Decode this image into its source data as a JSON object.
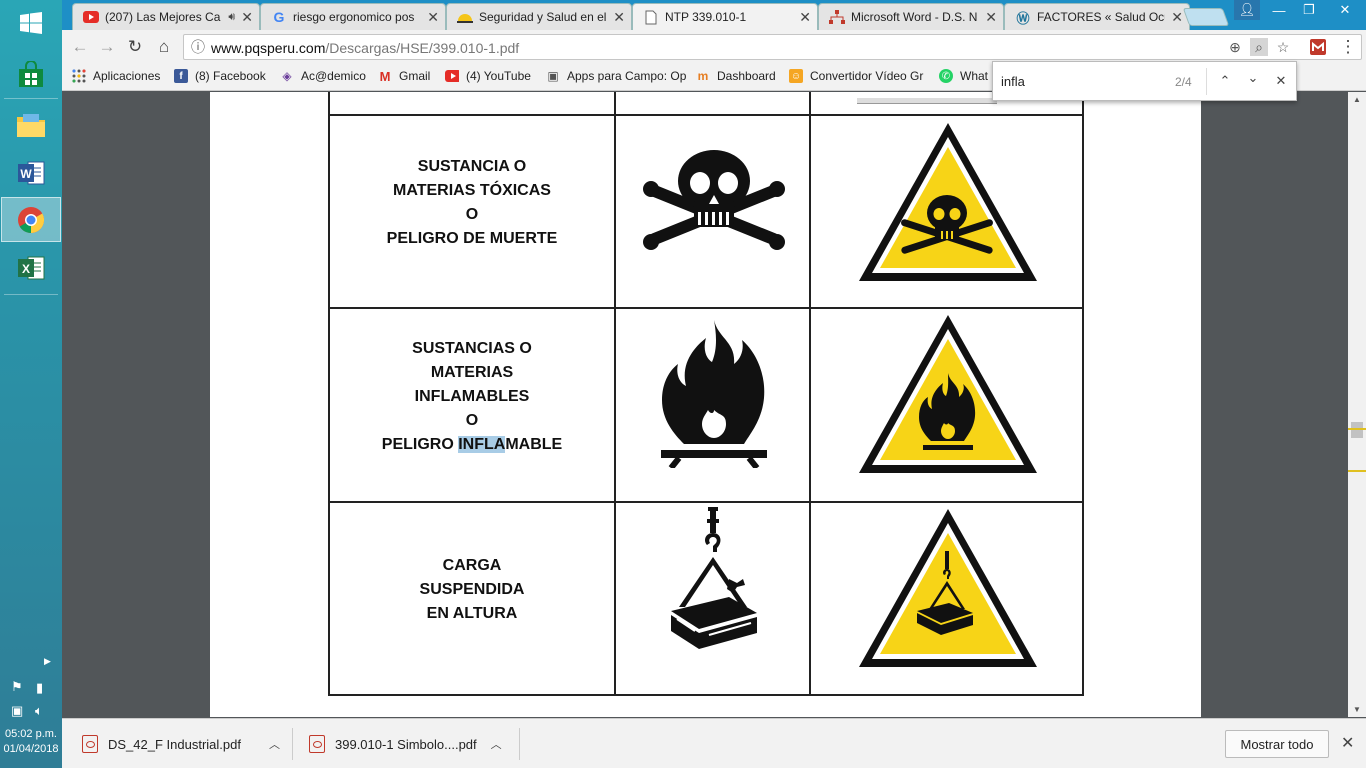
{
  "browser": {
    "tabs": [
      {
        "title": "(207) Las Mejores Ca",
        "favicon": "youtube-icon",
        "has_audio": true
      },
      {
        "title": "riesgo ergonomico pos",
        "favicon": "google-icon"
      },
      {
        "title": "Seguridad y Salud en el",
        "favicon": "helmet-icon"
      },
      {
        "title": "NTP 339.010-1",
        "favicon": "document-icon",
        "active": true
      },
      {
        "title": "Microsoft Word - D.S. N",
        "favicon": "sitemap-icon"
      },
      {
        "title": "FACTORES « Salud Ocu",
        "favicon": "wordpress-icon"
      }
    ],
    "url_host": "www.pqsperu.com",
    "url_path": "/Descargas/HSE/399.010-1.pdf",
    "bookmarks": [
      {
        "label": "Aplicaciones",
        "icon": "apps-grid-icon"
      },
      {
        "label": "(8) Facebook",
        "icon": "facebook-icon"
      },
      {
        "label": "Ac@demico",
        "icon": "academico-icon"
      },
      {
        "label": "Gmail",
        "icon": "gmail-icon"
      },
      {
        "label": "(4) YouTube",
        "icon": "youtube-icon"
      },
      {
        "label": "Apps para Campo: Op",
        "icon": "page-icon"
      },
      {
        "label": "Dashboard",
        "icon": "dashboard-icon"
      },
      {
        "label": "Convertidor Vídeo Gr",
        "icon": "converter-icon"
      },
      {
        "label": "What",
        "icon": "whatsapp-icon"
      }
    ],
    "find": {
      "query": "infla",
      "count": "2/4"
    }
  },
  "pdf": {
    "rows": [
      {
        "lines": [
          "SUSTANCIA O",
          "MATERIAS TÓXICAS",
          "O",
          "PELIGRO DE MUERTE"
        ],
        "symbol": "skull-crossbones-icon"
      },
      {
        "lines": [
          "SUSTANCIAS O",
          "MATERIAS",
          "INFLAMABLES",
          "O"
        ],
        "last_pre": "PELIGRO ",
        "last_hl": "INFLA",
        "last_post": "MABLE",
        "symbol": "flame-icon"
      },
      {
        "lines": [
          "CARGA",
          "SUSPENDIDA",
          "EN ALTURA"
        ],
        "symbol": "suspended-load-icon"
      }
    ],
    "warning_color": "#f7d417"
  },
  "downloads": {
    "items": [
      {
        "name": "DS_42_F Industrial.pdf"
      },
      {
        "name": "399.010-1 Simbolo....pdf"
      }
    ],
    "show_all": "Mostrar todo"
  },
  "taskbar": {
    "apps": [
      "windows-start-icon",
      "store-icon",
      "file-explorer-icon",
      "word-icon",
      "chrome-icon",
      "excel-icon"
    ],
    "time": "05:02 p.m.",
    "date": "01/04/2018"
  }
}
